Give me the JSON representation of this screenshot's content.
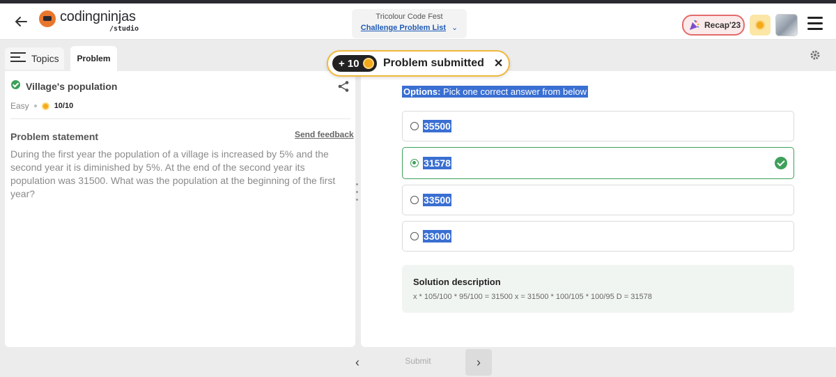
{
  "header": {
    "logo_main": "codingninjas",
    "logo_sub": "/studio",
    "event_title": "Tricolour Code Fest",
    "event_link": "Challenge Problem List",
    "recap_label": "Recap'23"
  },
  "tabs": {
    "topics_label": "Topics",
    "problem_label": "Problem"
  },
  "toast": {
    "points": "+ 10",
    "message": "Problem submitted",
    "close_glyph": "✕"
  },
  "problem": {
    "title": "Village's population",
    "difficulty": "Easy",
    "score": "10/10",
    "statement_title": "Problem statement",
    "feedback_label": "Send feedback",
    "statement": "During the first year the population of a village is increased by 5% and the second year it is diminished by 5%. At the end of the second year its population was 31500. What was the population at the beginning of the first year?"
  },
  "options": {
    "header_bold": "Options:",
    "header_rest": " Pick one correct answer from below",
    "items": [
      {
        "value": "35500",
        "selected": false,
        "correct": false
      },
      {
        "value": "31578",
        "selected": true,
        "correct": true
      },
      {
        "value": "33500",
        "selected": false,
        "correct": false
      },
      {
        "value": "33000",
        "selected": false,
        "correct": false
      }
    ]
  },
  "solution": {
    "title": "Solution description",
    "text": "x * 105/100 * 95/100 = 31500 x = 31500 * 100/105 * 100/95 D = 31578"
  },
  "footer": {
    "prev_glyph": "‹",
    "submit_label": "Submit",
    "next_glyph": "›"
  },
  "icons": {
    "back": "back-arrow-icon",
    "menu": "hamburger-menu-icon",
    "gear": "gear-icon",
    "share": "share-icon",
    "coin": "coin-icon",
    "check": "check-circle-icon"
  },
  "colors": {
    "accent_blue": "#3a6fd2",
    "success_green": "#3ea05a",
    "toast_border": "#f0b83b",
    "recap_border": "#e36b6b"
  }
}
